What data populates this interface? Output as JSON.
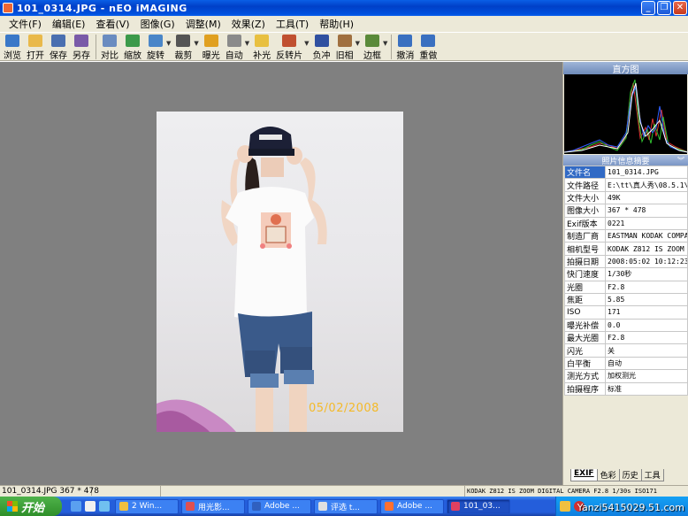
{
  "window": {
    "title": "101_0314.JPG - nEO iMAGING"
  },
  "menu": [
    "文件(F)",
    "编辑(E)",
    "查看(V)",
    "图像(G)",
    "调整(M)",
    "效果(Z)",
    "工具(T)",
    "帮助(H)"
  ],
  "toolbar": [
    {
      "label": "浏览",
      "icon": "browse-icon",
      "color": "#3a78c8"
    },
    {
      "label": "打开",
      "icon": "open-folder-icon",
      "color": "#e9b94a"
    },
    {
      "label": "保存",
      "icon": "save-icon",
      "color": "#4a6fb0"
    },
    {
      "label": "另存",
      "icon": "save-as-icon",
      "color": "#7a5aa8"
    },
    {
      "label": "对比",
      "icon": "compare-icon",
      "color": "#6a8cc0"
    },
    {
      "label": "缩放",
      "icon": "zoom-icon",
      "color": "#3c9a4a"
    },
    {
      "label": "旋转",
      "icon": "rotate-icon",
      "color": "#4a86c8",
      "dropdown": true
    },
    {
      "label": "裁剪",
      "icon": "crop-icon",
      "color": "#555555",
      "dropdown": true
    },
    {
      "label": "曝光",
      "icon": "exposure-icon",
      "color": "#e0a020"
    },
    {
      "label": "自动",
      "icon": "auto-icon",
      "color": "#8a8a8a",
      "dropdown": true
    },
    {
      "label": "补光",
      "icon": "fill-light-icon",
      "color": "#e8c040"
    },
    {
      "label": "反转片",
      "icon": "slide-film-icon",
      "color": "#c05030",
      "dropdown": true
    },
    {
      "label": "负冲",
      "icon": "cross-process-icon",
      "color": "#3050a0"
    },
    {
      "label": "旧相",
      "icon": "old-photo-icon",
      "color": "#a07040",
      "dropdown": true
    },
    {
      "label": "边框",
      "icon": "frame-icon",
      "color": "#5a8a3a",
      "dropdown": true
    },
    {
      "label": "撤消",
      "icon": "undo-icon",
      "color": "#3a70c0"
    },
    {
      "label": "重做",
      "icon": "redo-icon",
      "color": "#3a70c0"
    }
  ],
  "photo": {
    "date_stamp": "05/02/2008"
  },
  "panel": {
    "histogram_title": "直方图",
    "info_title": "照片信息摘要",
    "rows": [
      {
        "key": "文件名",
        "value": "101_0314.JPG"
      },
      {
        "key": "文件路径",
        "value": "E:\\tt\\真人秀\\08.5.1\\"
      },
      {
        "key": "文件大小",
        "value": "49K"
      },
      {
        "key": "图像大小",
        "value": "367 * 478"
      },
      {
        "key": "Exif版本",
        "value": "0221"
      },
      {
        "key": "制造厂商",
        "value": "EASTMAN KODAK COMPAN"
      },
      {
        "key": "相机型号",
        "value": "KODAK Z812 IS ZOOM D"
      },
      {
        "key": "拍摄日期",
        "value": "2008:05:02 10:12:23"
      },
      {
        "key": "快门速度",
        "value": "1/30秒"
      },
      {
        "key": "光圈",
        "value": "F2.8"
      },
      {
        "key": "焦距",
        "value": "5.85"
      },
      {
        "key": "ISO",
        "value": "171"
      },
      {
        "key": "曝光补偿",
        "value": "0.0"
      },
      {
        "key": "最大光圈",
        "value": "F2.8"
      },
      {
        "key": "闪光",
        "value": "关"
      },
      {
        "key": "白平衡",
        "value": "自动"
      },
      {
        "key": "测光方式",
        "value": "加权测光"
      },
      {
        "key": "拍摄程序",
        "value": "标准"
      }
    ],
    "tabs": [
      "EXIF",
      "色彩",
      "历史",
      "工具"
    ]
  },
  "status": {
    "left": "101_0314.JPG 367 * 478",
    "right": "KODAK Z812 IS ZOOM DIGITAL CAMERA F2.8 1/30s ISO171"
  },
  "taskbar": {
    "start": "开始",
    "tasks": [
      {
        "label": "2 Win...",
        "color": "#f0c040"
      },
      {
        "label": "用光影...",
        "color": "#e05050"
      },
      {
        "label": "Adobe ...",
        "color": "#3060c0"
      },
      {
        "label": "评选 t...",
        "color": "#e0e0e0"
      },
      {
        "label": "Adobe ...",
        "color": "#ff7030"
      },
      {
        "label": "101_03...",
        "color": "#e04060"
      }
    ],
    "watermark": "Yanzi5415029.51.com"
  }
}
